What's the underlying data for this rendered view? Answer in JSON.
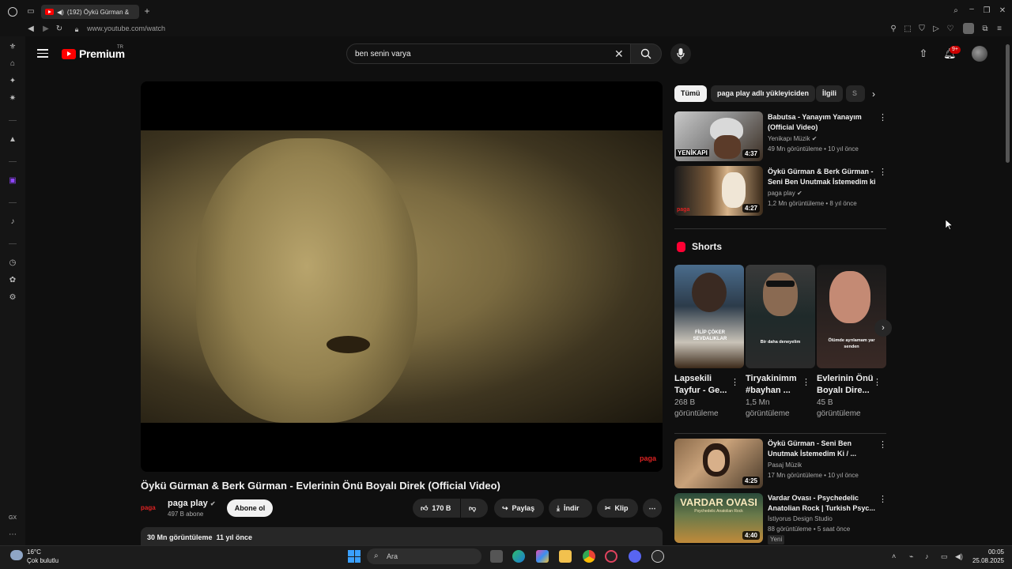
{
  "browser": {
    "tab_title": "(192) Öykü Gürman &",
    "url": "www.youtube.com/watch",
    "sidebar_label": "GX"
  },
  "header": {
    "logo_text": "Premium",
    "region": "TR",
    "search_value": "ben senin varya",
    "notifications": "9+",
    "icons": [
      "menu-icon",
      "search-icon",
      "mic-icon",
      "upload-icon",
      "bell-icon"
    ]
  },
  "video": {
    "title": "Öykü Gürman & Berk Gürman - Evlerinin Önü Boyalı Direk (Official Video)",
    "watermark": "paga",
    "channel": {
      "logo": "paga",
      "name": "paga play",
      "subscribers": "497 B abone"
    },
    "subscribe_label": "Abone ol",
    "likes": "170 B",
    "share_label": "Paylaş",
    "download_label": "İndir",
    "clip_label": "Klip",
    "views": "30 Mn görüntüleme",
    "age": "11 yıl önce"
  },
  "chips": [
    "Tümü",
    "paga play adlı yükleyiciden",
    "İlgili",
    "S"
  ],
  "related_top": [
    {
      "title": "Babutsa - Yanayım Yanayım (Official Video)",
      "channel": "Yenikapı Müzik",
      "meta": "49 Mn görüntüleme • 10 yıl önce",
      "duration": "4:37",
      "thumb_text": "YENİKAPI"
    },
    {
      "title": "Öykü Gürman & Berk Gürman - Seni Ben Unutmak İstemedim ki",
      "channel": "paga play",
      "meta": "1,2 Mn görüntüleme • 8 yıl önce",
      "duration": "4:27",
      "thumb_text": "paga"
    }
  ],
  "shorts": {
    "heading": "Shorts",
    "items": [
      {
        "title": "Lapsekili Tayfur - Ge...",
        "views": "268 B görüntüleme",
        "overlay": "FİLİP ÇÖKER SEVDALIKLAR"
      },
      {
        "title": "Tiryakinimm #bayhan ...",
        "views": "1,5 Mn görüntüleme",
        "overlay": "Bir daha deneyelim"
      },
      {
        "title": "Evlerinin Önü Boyalı Dire...",
        "views": "45 B görüntüleme",
        "overlay": "Ölümde ayrılamam yar senden"
      }
    ]
  },
  "related_bottom": [
    {
      "title": "Öykü Gürman - Seni Ben Unutmak İstemedim Ki / ...",
      "channel": "Pasaj Müzik",
      "meta": "17 Mn görüntüleme • 10 yıl önce",
      "duration": "4:25"
    },
    {
      "title": "Vardar Ovası - Psychedelic Anatolian Rock | Turkish Psyc...",
      "channel": "İstiyorus Design Studio",
      "meta": "88 görüntüleme • 5 saat önce",
      "duration": "4:40",
      "badge": "Yeni",
      "thumb_text": "VARDAR OVASI",
      "thumb_sub": "Psychedelic Anatolian Rock"
    }
  ],
  "taskbar": {
    "temperature": "16°C",
    "weather": "Çok bulutlu",
    "search_placeholder": "Ara",
    "time": "00:05",
    "date": "25.08.2025"
  }
}
